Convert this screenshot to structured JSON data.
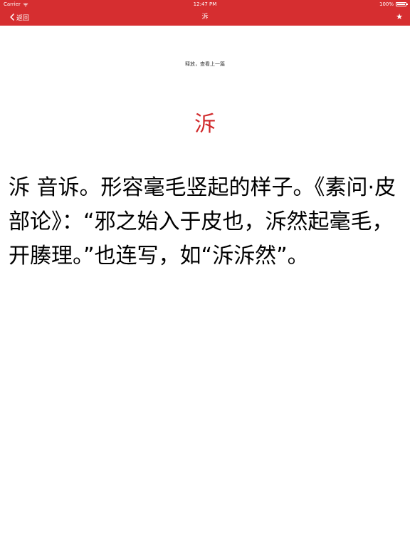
{
  "status_bar": {
    "carrier": "Carrier",
    "time": "12:47 PM",
    "battery": "100%"
  },
  "nav_bar": {
    "back_label": "返回",
    "title": "泝",
    "favorite_icon": "star-icon"
  },
  "content": {
    "pull_hint": "释放，查看上一篇",
    "headword": "泝",
    "definition": "泝 音诉。形容毫毛竖起的样子。《素问·皮部论》：“邪之始入于皮也，泝然起毫毛，开腠理。”也连写，如“泝泝然”。"
  },
  "colors": {
    "bar_background": "#d62e30",
    "headword": "#d0282a",
    "text": "#000000"
  }
}
